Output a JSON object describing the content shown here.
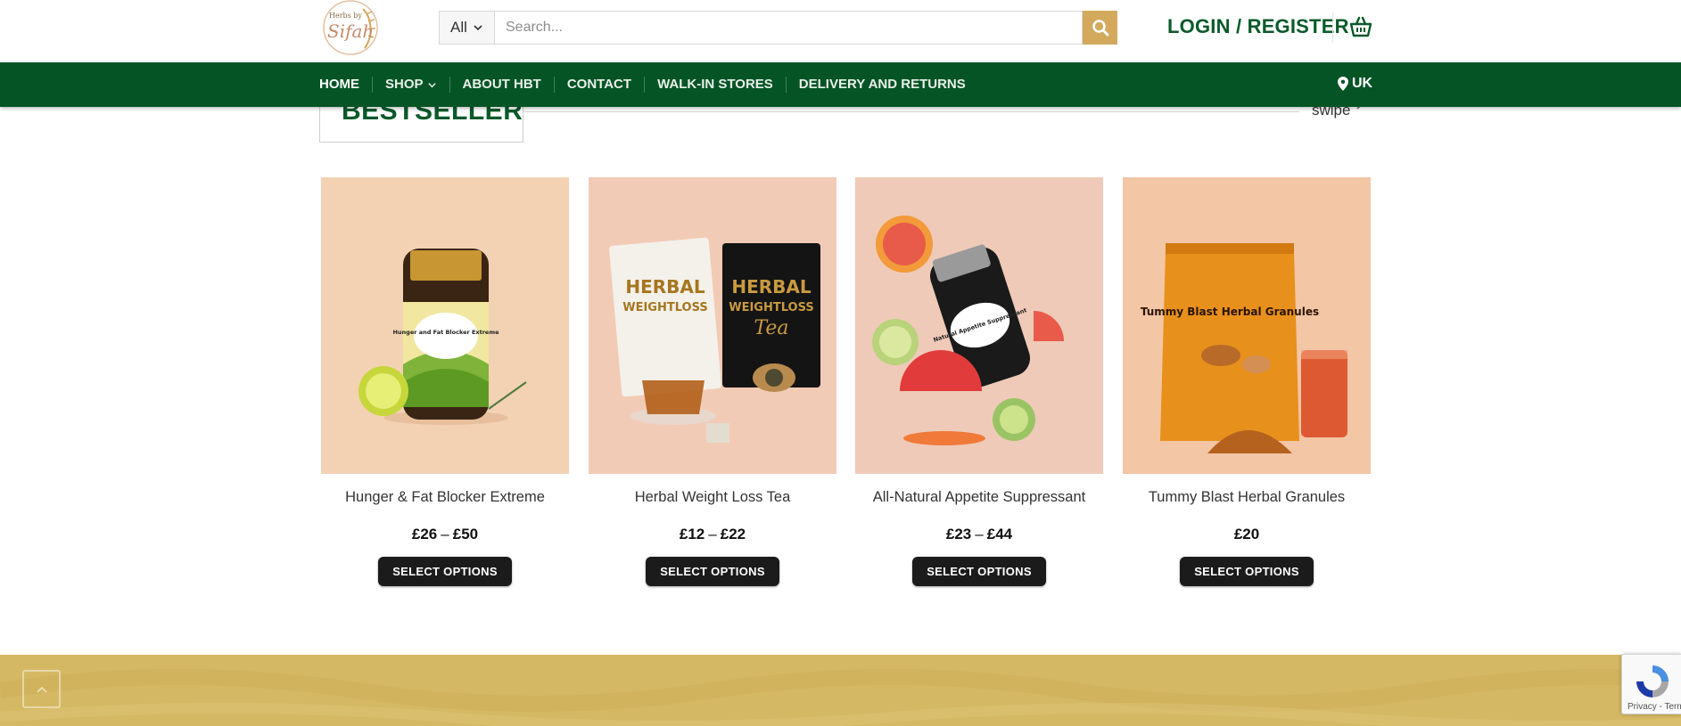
{
  "header": {
    "logo_alt": "Herbs by Sifah",
    "search": {
      "category_selected": "All",
      "placeholder": "Search...",
      "value": ""
    },
    "login_label": "LOGIN / REGISTER"
  },
  "nav": {
    "items": [
      {
        "label": "HOME",
        "active": true,
        "has_dropdown": false
      },
      {
        "label": "SHOP",
        "active": false,
        "has_dropdown": true
      },
      {
        "label": "ABOUT HBT",
        "active": false,
        "has_dropdown": false
      },
      {
        "label": "CONTACT",
        "active": false,
        "has_dropdown": false
      },
      {
        "label": "WALK-IN STORES",
        "active": false,
        "has_dropdown": false
      },
      {
        "label": "DELIVERY AND RETURNS",
        "active": false,
        "has_dropdown": false
      }
    ],
    "region_label": "UK"
  },
  "section": {
    "title": "BESTSELLER",
    "swipe_label": "swipe"
  },
  "products": [
    {
      "name": "Hunger & Fat Blocker Extreme",
      "price_min": "£26",
      "price_max": "£50",
      "button": "SELECT OPTIONS"
    },
    {
      "name": "Herbal Weight Loss Tea",
      "price_min": "£12",
      "price_max": "£22",
      "button": "SELECT OPTIONS"
    },
    {
      "name": "All-Natural Appetite Suppressant",
      "price_min": "£23",
      "price_max": "£44",
      "button": "SELECT OPTIONS"
    },
    {
      "name": "Tummy Blast Herbal Granules",
      "price_min": "£20",
      "price_max": "",
      "button": "SELECT OPTIONS"
    }
  ],
  "product_images": {
    "p1_label": "Hunger and Fat Blocker Extreme",
    "p2_label_top": "HERBAL",
    "p2_label_mid": "WEIGHTLOSS",
    "p2_label_bottom": "Tea",
    "p3_label": "Natural Appetite Suppressant",
    "p4_label": "Tummy Blast Herbal Granules"
  },
  "recaptcha": {
    "text": "Privacy - Terms"
  },
  "colors": {
    "brand_green": "#045426",
    "heading_green": "#0a5a2a",
    "gold": "#d2a95d",
    "footer_gold": "#d4b863",
    "button_dark": "#1b1b1b"
  }
}
